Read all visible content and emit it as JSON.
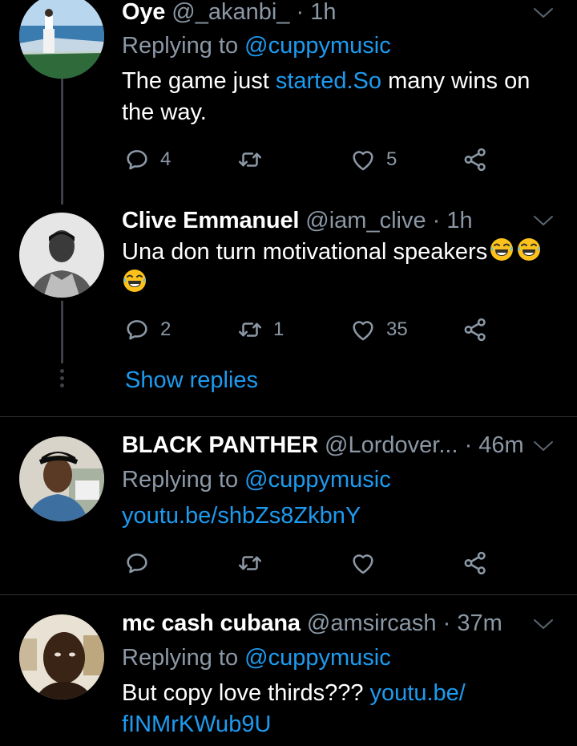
{
  "tweets": [
    {
      "name": "Oye",
      "handle": "@_akanbi_",
      "dot": "·",
      "time": "1h",
      "replying_prefix": "Replying to ",
      "replying_to": "@cuppymusic",
      "text_before": "The game just ",
      "text_link": "started.So",
      "text_after": " many wins on the way.",
      "reply_count": "4",
      "retweet_count": "",
      "like_count": "5"
    },
    {
      "name": "Clive Emmanuel",
      "handle": "@iam_clive",
      "dot": "·",
      "time": "1h",
      "text": "Una don turn motivational speakers",
      "emoji_name": "face-with-tears-of-joy",
      "reply_count": "2",
      "retweet_count": "1",
      "like_count": "35",
      "show_replies": "Show replies"
    },
    {
      "name": "BLACK PANTHER",
      "handle": "@Lordover...",
      "dot": "·",
      "time": "46m",
      "replying_prefix": "Replying to ",
      "replying_to": "@cuppymusic",
      "link": "youtu.be/shbZs8ZkbnY",
      "reply_count": "",
      "retweet_count": "",
      "like_count": ""
    },
    {
      "name": "mc cash cubana",
      "handle": "@amsircash",
      "dot": "·",
      "time": "37m",
      "replying_prefix": "Replying to ",
      "replying_to": "@cuppymusic",
      "text_before": "But copy love thirds??? ",
      "link_line1": "youtu.be/",
      "link_line2": "fINMrKWub9U"
    }
  ],
  "icons": {
    "reply": "speech-bubble-icon",
    "retweet": "retweet-arrows-icon",
    "like": "heart-icon",
    "share": "share-nodes-icon",
    "menu": "chevron-down-icon"
  },
  "colors": {
    "background": "#000000",
    "text": "#ffffff",
    "muted": "#8b98a5",
    "link": "#1d9bf0",
    "divider": "#2f3336"
  }
}
